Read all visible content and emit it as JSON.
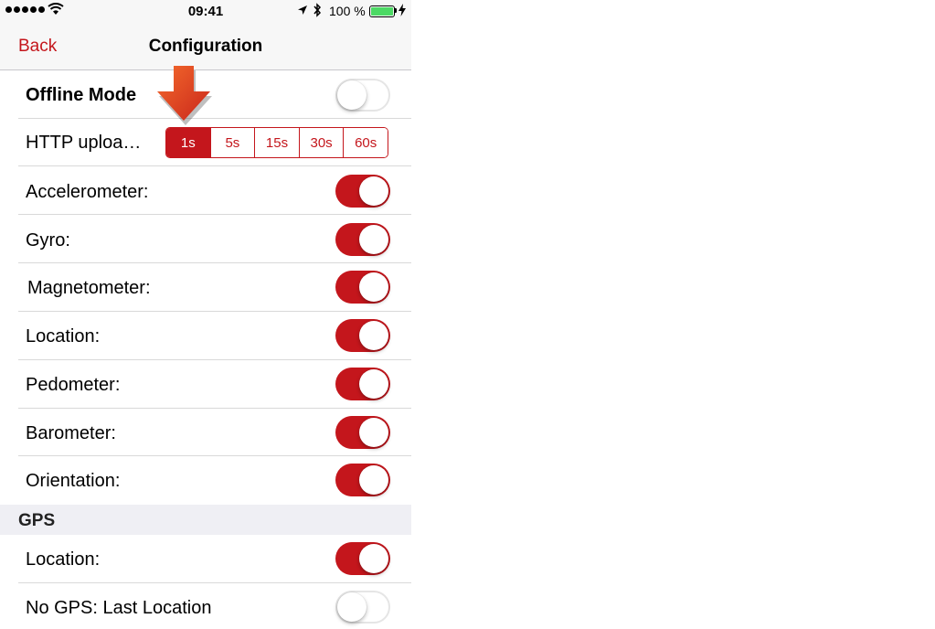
{
  "status_bar": {
    "time": "09:41",
    "battery": "100 %"
  },
  "nav": {
    "back": "Back",
    "title": "Configuration"
  },
  "offline_mode": {
    "label": "Offline Mode",
    "on": false
  },
  "http_upload": {
    "label": "HTTP uploa…",
    "options": [
      "1s",
      "5s",
      "15s",
      "30s",
      "60s"
    ],
    "selected": "1s"
  },
  "sensors": [
    {
      "label": "Accelerometer:",
      "on": true
    },
    {
      "label": "Gyro:",
      "on": true
    },
    {
      "label": "Magnetometer:",
      "on": true
    },
    {
      "label": "Location:",
      "on": true
    },
    {
      "label": "Pedometer:",
      "on": true
    },
    {
      "label": "Barometer:",
      "on": true
    },
    {
      "label": "Orientation:",
      "on": true
    }
  ],
  "gps": {
    "header": "GPS",
    "items": [
      {
        "label": "Location:",
        "on": true
      },
      {
        "label": "No GPS: Last Location",
        "on": false
      }
    ]
  },
  "colors": {
    "accent": "#c4161c",
    "battery": "#4cd964"
  }
}
